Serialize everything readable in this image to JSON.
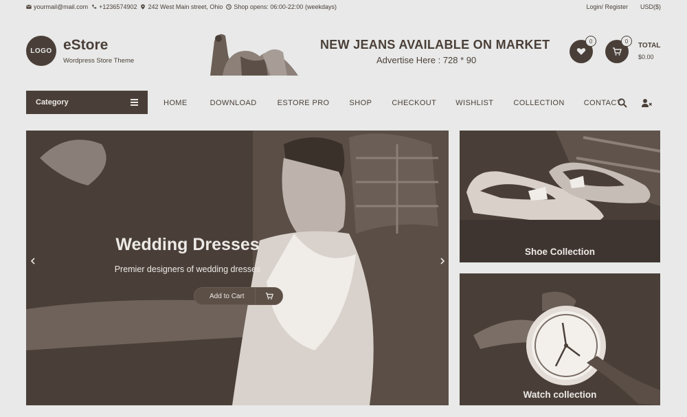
{
  "topbar": {
    "email": "yourmail@mail.com",
    "phone": "+1236574902",
    "address": "242 West Main street, Ohio",
    "hours": "Shop opens: 06:00-22:00 (weekdays)",
    "login": "Login/ Register",
    "currency": "USD($)"
  },
  "header": {
    "logo_text": "LOGO",
    "site_name": "eStore",
    "tagline": "Wordpress Store Theme",
    "ad_title": "NEW JEANS AVAILABLE ON MARKET",
    "ad_subtitle": "Advertise Here : 728 * 90",
    "wishlist_count": "0",
    "cart_count": "0",
    "total_label": "TOTAL",
    "total_value": "$0.00"
  },
  "nav": {
    "category_label": "Category",
    "items": [
      "HOME",
      "DOWNLOAD",
      "ESTORE PRO",
      "SHOP",
      "CHECKOUT",
      "WISHLIST",
      "COLLECTION",
      "CONTACT"
    ]
  },
  "slider": {
    "title": "Wedding Dresses",
    "subtitle": "Premier designers of wedding dresses",
    "button_label": "Add to Cart"
  },
  "promos": [
    {
      "label": "Shoe Collection"
    },
    {
      "label": "Watch collection"
    }
  ],
  "colors": {
    "primary": "#4a3f38",
    "background": "#e8e9e8",
    "text_light": "#ece9e6"
  },
  "icons": [
    "mail-icon",
    "phone-icon",
    "location-icon",
    "clock-icon",
    "heart-icon",
    "cart-icon",
    "menu-icon",
    "search-icon",
    "user-icon",
    "chevron-left-icon",
    "chevron-right-icon"
  ]
}
